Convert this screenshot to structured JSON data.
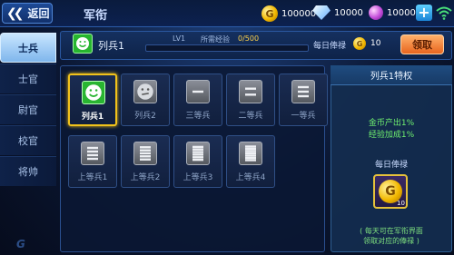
{
  "topbar": {
    "back_label": "返回",
    "title": "军衔",
    "gold": "100000",
    "diamond": "10000",
    "gem": "10000",
    "gold_icon_letter": "G"
  },
  "nav": {
    "items": [
      "士兵",
      "士官",
      "尉官",
      "校官",
      "将帅"
    ],
    "active_index": 0
  },
  "header": {
    "rank_name": "列兵1",
    "level": "LV1",
    "exp_label": "所需经验",
    "exp_value": "0/500",
    "exp_fraction": 0,
    "salary_label": "每日俸禄",
    "salary_amount": "10",
    "claim_label": "领取"
  },
  "grid": {
    "rows": [
      [
        "列兵1",
        "列兵2",
        "三等兵",
        "二等兵",
        "一等兵"
      ],
      [
        "上等兵1",
        "上等兵2",
        "上等兵3",
        "上等兵4"
      ]
    ],
    "selected": "列兵1"
  },
  "privilege": {
    "title": "列兵1特权",
    "lines": [
      "金币产出1%",
      "经验加成1%"
    ],
    "daily_label": "每日俸禄",
    "daily_count": "10",
    "note_lines": [
      "( 每天可在军衔界面",
      "领取对应的俸禄 )"
    ]
  },
  "colors": {
    "accent_gold": "#f1c21b",
    "claim_orange": "#e8651e",
    "bonus_green": "#6ff06f"
  }
}
